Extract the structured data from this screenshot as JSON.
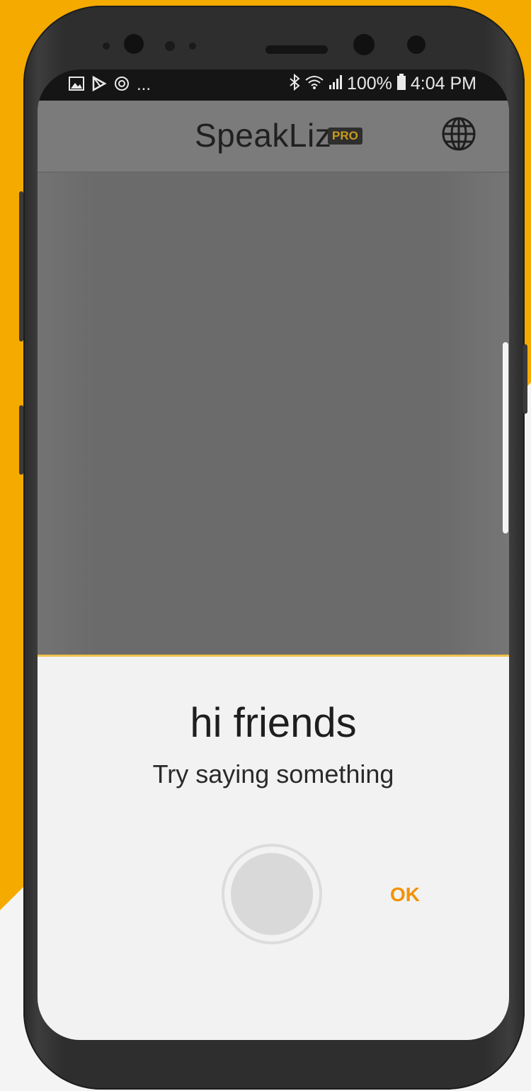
{
  "status_bar": {
    "left_icons": [
      "image-icon",
      "play-store-icon",
      "sync-icon"
    ],
    "left_more": "...",
    "right_icons": [
      "bluetooth-icon",
      "wifi-icon",
      "signal-icon",
      "battery-icon"
    ],
    "battery": "100%",
    "time": "4:04 PM"
  },
  "app_bar": {
    "title": "SpeakLiz",
    "badge": "PRO",
    "action_icon": "globe-icon"
  },
  "recognition_sheet": {
    "recognized_text": "hi friends",
    "hint": "Try saying something",
    "mic_button_icon": "microphone-button",
    "ok_label": "OK"
  },
  "colors": {
    "accent": "#f39200",
    "background_yellow": "#f5aa00",
    "sheet_border": "#f0c24a"
  }
}
